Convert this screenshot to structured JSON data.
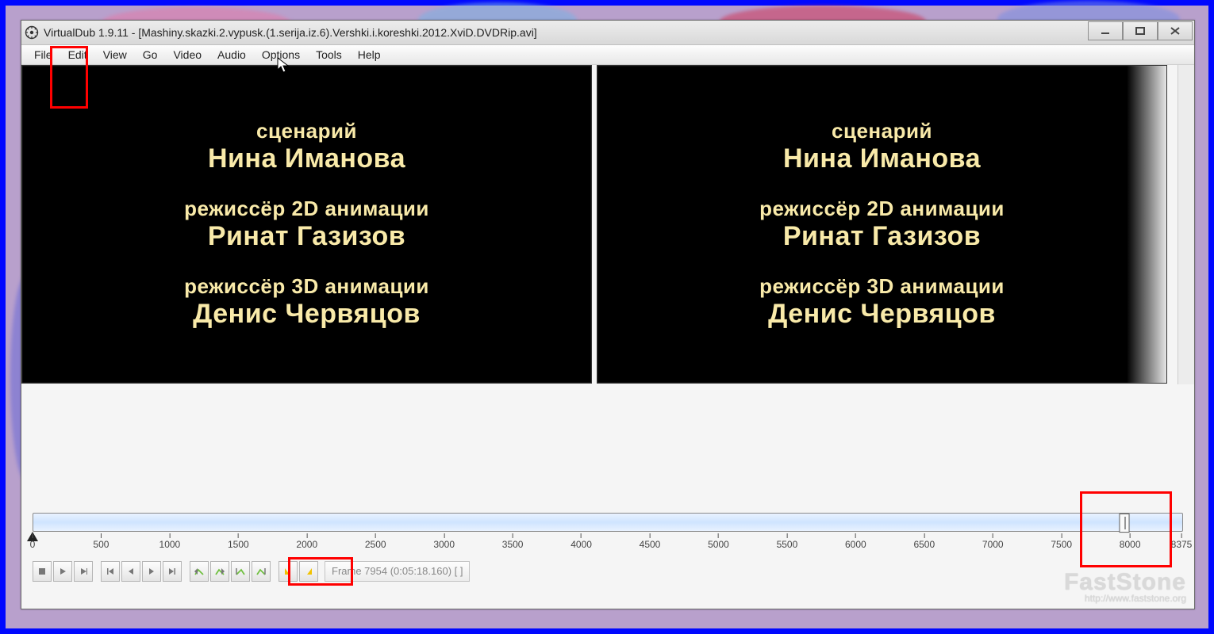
{
  "title": "VirtualDub 1.9.11 - [Mashiny.skazki.2.vypusk.(1.serija.iz.6).Vershki.i.koreshki.2012.XviD.DVDRip.avi]",
  "menu": {
    "file": "File",
    "edit": "Edit",
    "view": "View",
    "go": "Go",
    "video": "Video",
    "audio": "Audio",
    "options": "Options",
    "tools": "Tools",
    "help": "Help"
  },
  "credits": [
    {
      "role": "сценарий",
      "name": "Нина Иманова"
    },
    {
      "role": "режиссёр 2D анимации",
      "name": "Ринат Газизов"
    },
    {
      "role": "режиссёр 3D анимации",
      "name": "Денис Червяцов"
    }
  ],
  "timeline": {
    "ticks": [
      0,
      500,
      1000,
      1500,
      2000,
      2500,
      3000,
      3500,
      4000,
      4500,
      5000,
      5500,
      6000,
      6500,
      7000,
      7500,
      8000
    ],
    "last_tick_extra": "8375",
    "max": 8375,
    "current_frame": 7954
  },
  "status": "Frame 7954 (0:05:18.160)  [ ]",
  "watermark": {
    "brand": "FastStone",
    "sub": "http://www.faststone.org"
  }
}
